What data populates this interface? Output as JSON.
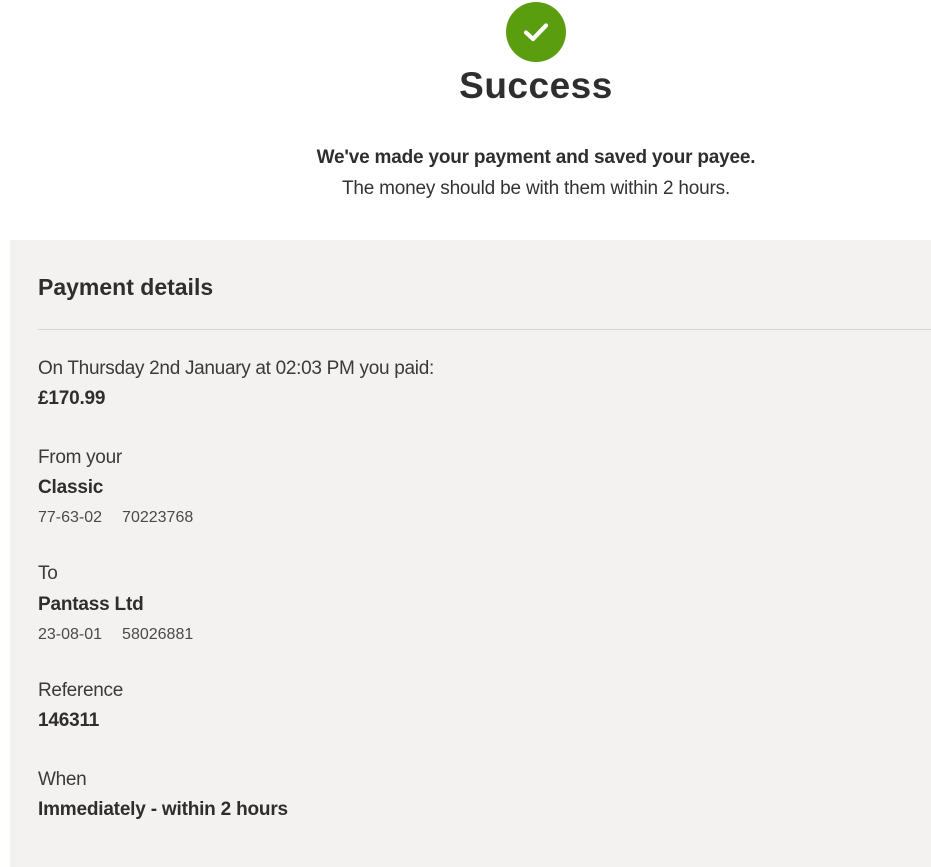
{
  "header": {
    "icon": "checkmark-icon",
    "accent_color": "#5a9e0f",
    "title": "Success",
    "message_bold": "We've made your payment and saved your payee.",
    "message": "The money should be with them within 2 hours."
  },
  "details": {
    "title": "Payment details",
    "paid": {
      "label": "On Thursday 2nd January at 02:03 PM you paid:",
      "amount": "£170.99"
    },
    "from": {
      "label": "From your",
      "account_name": "Classic",
      "sort_code": "77-63-02",
      "account_number": "70223768"
    },
    "to": {
      "label": "To",
      "payee_name": "Pantass Ltd",
      "sort_code": "23-08-01",
      "account_number": "58026881"
    },
    "reference": {
      "label": "Reference",
      "value": "146311"
    },
    "when": {
      "label": "When",
      "value": "Immediately - within 2 hours"
    }
  }
}
